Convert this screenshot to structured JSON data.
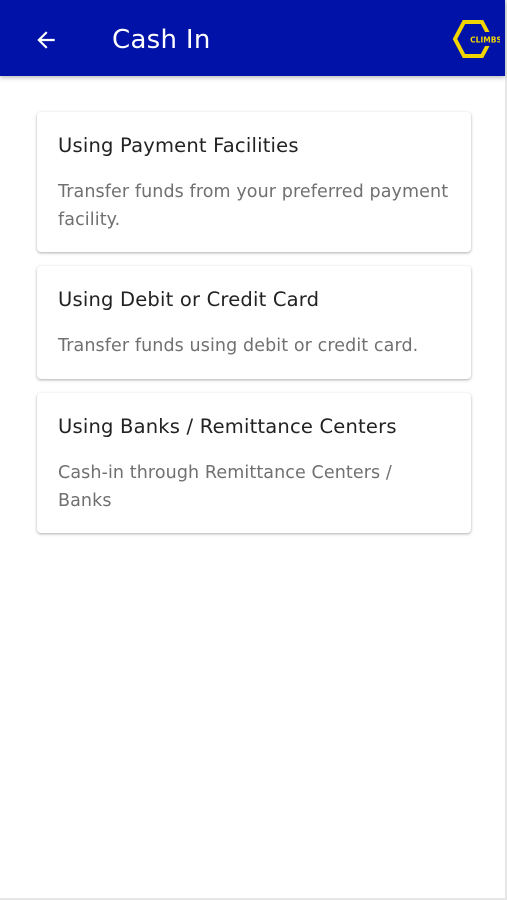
{
  "header": {
    "title": "Cash In",
    "back_icon": "arrow-left-icon",
    "logo_text": "CLIMBS",
    "background_color": "#0012a8",
    "logo_color": "#f2d500"
  },
  "options": [
    {
      "title": "Using Payment Facilities",
      "description": "Transfer funds from your preferred payment facility."
    },
    {
      "title": "Using Debit or Credit Card",
      "description": "Transfer funds using debit or credit card."
    },
    {
      "title": "Using Banks / Remittance Centers",
      "description": "Cash-in through Remittance Centers / Banks"
    }
  ]
}
